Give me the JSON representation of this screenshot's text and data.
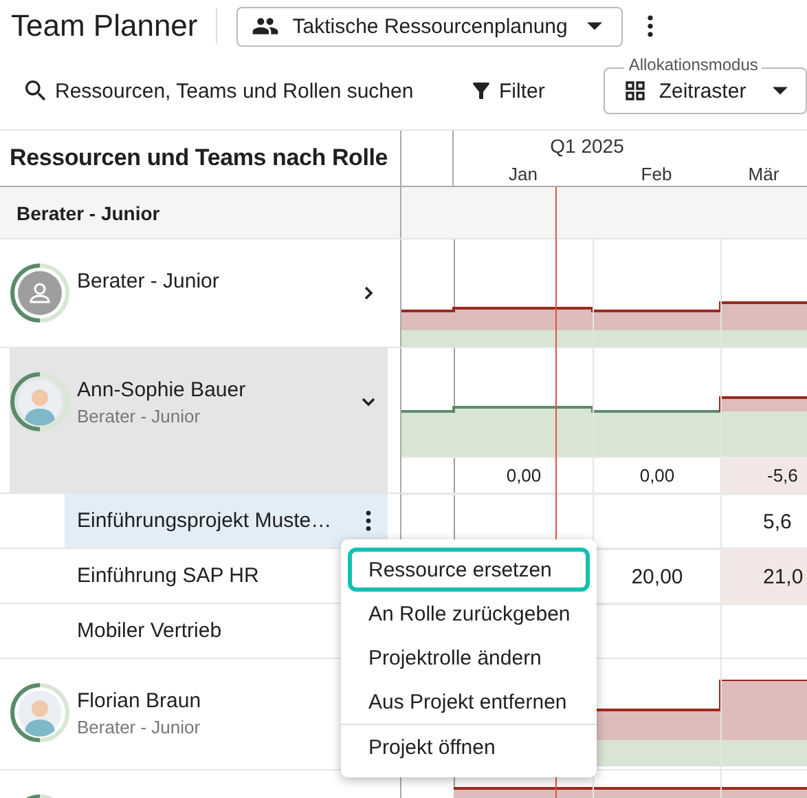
{
  "app": {
    "title": "Team Planner",
    "view_selector": "Taktische Ressourcenplanung"
  },
  "toolbar": {
    "search": {
      "placeholder": "Ressourcen, Teams und Rollen suchen"
    },
    "filter": "Filter",
    "mode": {
      "label": "Allokationsmodus",
      "value": "Zeitraster"
    }
  },
  "table": {
    "title": "Ressourcen und Teams nach Rolle",
    "quarter": "Q1 2025",
    "months": [
      "Jan",
      "Feb",
      "Mär"
    ],
    "rows": [
      {
        "kind": "group",
        "label": "Berater - Junior"
      },
      {
        "kind": "role",
        "name": "Berater - Junior",
        "expanded": false
      },
      {
        "kind": "person",
        "name": "Ann-Sophie Bauer",
        "role": "Berater - Junior",
        "expanded": true,
        "cells": [
          {
            "overbooked": false
          },
          {
            "text": "0,00",
            "overbooked": false
          },
          {
            "text": "0,00",
            "overbooked": false
          },
          {
            "text": "-5,6",
            "overbooked": true
          }
        ]
      },
      {
        "kind": "project",
        "name": "Einführungsprojekt Muste…",
        "selected": true,
        "cells": [
          {
            "overbooked": false
          },
          {
            "overbooked": false
          },
          {
            "overbooked": false
          },
          {
            "text": "5,6",
            "overbooked": false
          }
        ]
      },
      {
        "kind": "project",
        "name": "Einführung SAP HR",
        "selected": false,
        "cells": [
          null,
          null,
          {
            "text": "20,00",
            "overbooked": false
          },
          {
            "text": "21,0",
            "overbooked": true
          }
        ]
      },
      {
        "kind": "project",
        "name": "Mobiler Vertrieb",
        "selected": false
      },
      {
        "kind": "person",
        "name": "Florian Braun",
        "role": "Berater - Junior"
      },
      {
        "kind": "person"
      }
    ]
  },
  "context_menu": {
    "items": [
      {
        "label": "Ressource ersetzen",
        "selected": true,
        "divider_before": false
      },
      {
        "label": "An Rolle zurückgeben",
        "selected": false,
        "divider_before": false
      },
      {
        "label": "Projektrolle ändern",
        "selected": false,
        "divider_before": false
      },
      {
        "label": "Aus Projekt entfernen",
        "selected": false,
        "divider_before": false
      },
      {
        "label": "Projekt öffnen",
        "selected": false,
        "divider_before": true
      }
    ]
  }
}
